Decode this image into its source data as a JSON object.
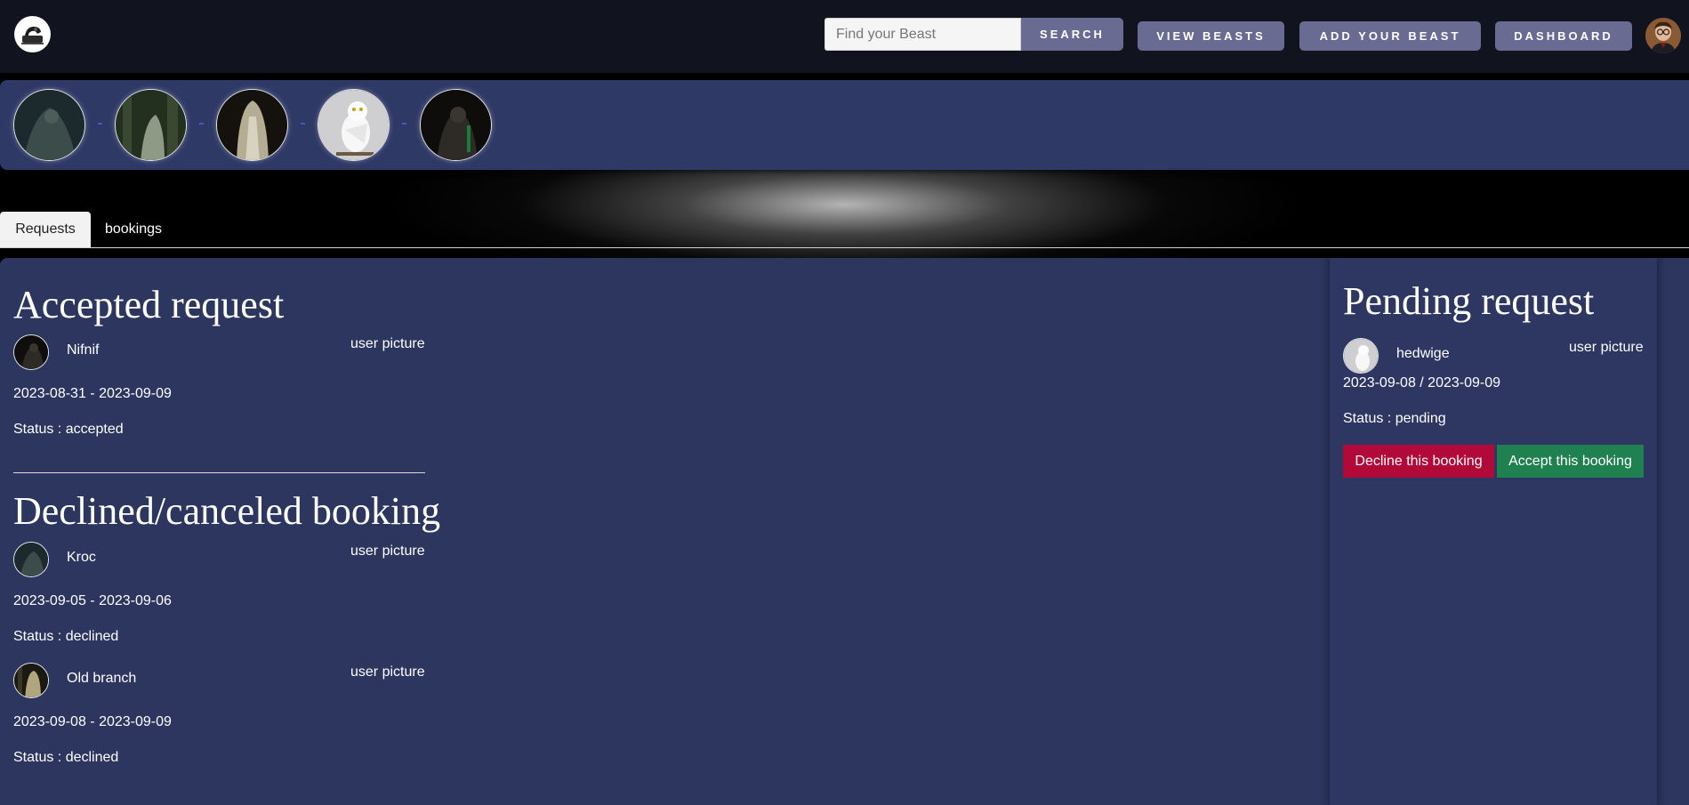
{
  "nav": {
    "logo_icon": "beast-logo-icon",
    "search_placeholder": "Find your Beast",
    "search_label": "SEARCH",
    "view_label": "VIEW BEASTS",
    "add_label": "ADD YOUR BEAST",
    "dashboard_label": "DASHBOARD",
    "avatar_icon": "user-avatar-icon"
  },
  "beasts": [
    {
      "name": "beast-thumb-1",
      "colors": [
        "#1c2a2e",
        "#3b4c4a"
      ]
    },
    {
      "name": "beast-thumb-2",
      "colors": [
        "#24301f",
        "#5a6850"
      ]
    },
    {
      "name": "beast-thumb-3",
      "colors": [
        "#15120e",
        "#b5ac94"
      ]
    },
    {
      "name": "beast-thumb-4",
      "colors": [
        "#d6d6d6",
        "#ffffff"
      ]
    },
    {
      "name": "beast-thumb-5",
      "colors": [
        "#0e0d0c",
        "#2e2a26"
      ]
    }
  ],
  "tabs": {
    "requests": "Requests",
    "bookings": "bookings"
  },
  "accepted": {
    "title": "Accepted request",
    "items": [
      {
        "beast": "Nifnif",
        "user_picture": "user picture",
        "dates": "2023-08-31 - 2023-09-09",
        "status": "Status : accepted"
      }
    ]
  },
  "declined": {
    "title": "Declined/canceled booking",
    "items": [
      {
        "beast": "Kroc",
        "user_picture": "user picture",
        "dates": "2023-09-05 - 2023-09-06",
        "status": "Status : declined"
      },
      {
        "beast": "Old branch",
        "user_picture": "user picture",
        "dates": "2023-09-08 - 2023-09-09",
        "status": "Status : declined"
      }
    ]
  },
  "pending": {
    "title": "Pending request",
    "items": [
      {
        "beast": "hedwige",
        "user_picture": "user picture",
        "dates": "2023-09-08 / 2023-09-09",
        "status": "Status : pending",
        "decline_label": "Decline this booking",
        "accept_label": "Accept this booking"
      }
    ]
  },
  "colors": {
    "panel": "#2c365e",
    "button": "#6a6b92",
    "decline": "#b2093b",
    "accept": "#1f8050"
  }
}
